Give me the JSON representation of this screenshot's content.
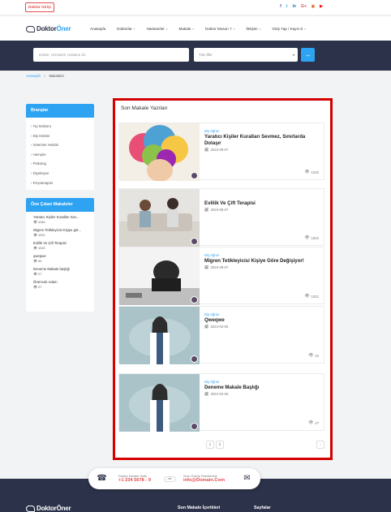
{
  "topbar": {
    "doctor_login": "Doktor Girişi",
    "socials": [
      {
        "icon": "facebook-icon",
        "glyph": "f",
        "color": "#3b5998"
      },
      {
        "icon": "twitter-icon",
        "glyph": "t",
        "color": "#1da1f2"
      },
      {
        "icon": "linkedin-icon",
        "glyph": "in",
        "color": "#0e76a8"
      },
      {
        "icon": "google-plus-icon",
        "glyph": "G+",
        "color": "#dd4b39"
      },
      {
        "icon": "rss-icon",
        "glyph": "◉",
        "color": "#f26522"
      },
      {
        "icon": "youtube-icon",
        "glyph": "▶",
        "color": "#ff0000"
      }
    ]
  },
  "brand": {
    "name_part1": "Doktor",
    "name_part2": "Öner"
  },
  "nav": {
    "items": [
      "Anasayfa",
      "Doktorlar",
      "Hastaneler",
      "Makale",
      "Doktor Musun ?",
      "İletişim",
      "Giriş Yap / Kayıt ol"
    ]
  },
  "search": {
    "placeholder": "Doktor, Uzmanlık, Hastane vb.",
    "city_select": "Tüm İller",
    "button_glyph": "→"
  },
  "breadcrumb": {
    "home": "Anasayfa",
    "separator": ">",
    "current": "Makaleler"
  },
  "sidebar": {
    "branches_title": "Branşlar",
    "branches": [
      "Tıp Doktoru",
      "Diş Hekimi",
      "Veteriner Hekimi",
      "Hemşire",
      "Psikolog",
      "Diyetisyen",
      "Fizyoterapist"
    ],
    "featured_title": "Öne Çıkan Makaleler",
    "featured": [
      {
        "title": "Yaratıcı Kişiler Kuralları Sev...",
        "views": "1040"
      },
      {
        "title": "Migren Tetikleyicisi Kişiye gör...",
        "views": "1021"
      },
      {
        "title": "Evlilik Ve Çift Terapisi",
        "views": "1022"
      },
      {
        "title": "qweqwe",
        "views": "34"
      },
      {
        "title": "Deneme Makale başlığı",
        "views": "27"
      },
      {
        "title": "Örümcek Adam",
        "views": "27"
      }
    ]
  },
  "main": {
    "title": "Son Makale Yazıları",
    "articles": [
      {
        "category": "Diş Ağrısı",
        "title": "Yaratıcı Kişiler Kuralları Sevmez, Sınırlarda Dolaşır",
        "date": "2023-09-07",
        "views": "1040"
      },
      {
        "category": "",
        "title": "Evlilik Ve Çift Terapisi",
        "date": "2023-09-07",
        "views": "1022"
      },
      {
        "category": "Diş Ağrısı",
        "title": "Migren Tetikleyicisi Kişiye Göre Değişiyor!",
        "date": "2023-09-07",
        "views": "1021"
      },
      {
        "category": "Diş Ağrısı",
        "title": "Qweqwe",
        "date": "2024-02-06",
        "views": "34"
      },
      {
        "category": "Diş Ağrısı",
        "title": "Deneme Makale Başlığı",
        "date": "2024-02-06",
        "views": "27"
      }
    ],
    "pages": [
      "1",
      "2"
    ],
    "next_glyph": "›"
  },
  "contact": {
    "phone_label": "Doktor Destek Hattı",
    "phone": "+1 234 5678 - 9",
    "or": "- ve -",
    "email_label": "Soru Görüş Önerileriniz",
    "email": "info@Domain.Com"
  },
  "footer": {
    "col1": "Son Makale İçerikleri",
    "col2": "Sayfalar"
  }
}
